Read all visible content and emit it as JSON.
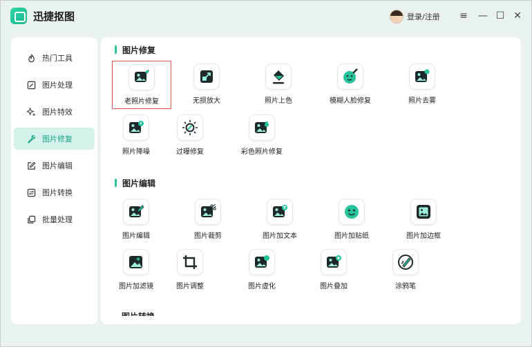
{
  "app": {
    "title": "迅捷抠图",
    "login_label": "登录/注册"
  },
  "window_controls": {
    "menu": "≡",
    "minimize": "—",
    "maximize": "☐",
    "close": "✕"
  },
  "sidebar": {
    "items": [
      {
        "label": "热门工具",
        "icon": "fire-icon",
        "active": false
      },
      {
        "label": "图片处理",
        "icon": "image-edit-icon",
        "active": false
      },
      {
        "label": "图片特效",
        "icon": "sparkle-icon",
        "active": false
      },
      {
        "label": "图片修复",
        "icon": "wrench-icon",
        "active": true
      },
      {
        "label": "图片编辑",
        "icon": "pencil-square-icon",
        "active": false
      },
      {
        "label": "图片转换",
        "icon": "convert-icon",
        "active": false
      },
      {
        "label": "批量处理",
        "icon": "stack-icon",
        "active": false
      }
    ]
  },
  "sections": [
    {
      "title": "图片修复",
      "tools": [
        {
          "label": "老照片修复",
          "icon": "old-photo-repair-icon",
          "selected": true
        },
        {
          "label": "无损放大",
          "icon": "upscale-icon"
        },
        {
          "label": "照片上色",
          "icon": "paint-bucket-icon"
        },
        {
          "label": "模糊人脸修复",
          "icon": "face-repair-icon"
        },
        {
          "label": "照片去雾",
          "icon": "dehaze-icon"
        },
        {
          "label": "照片降噪",
          "icon": "denoise-icon"
        },
        {
          "label": "过曝修复",
          "icon": "exposure-icon"
        },
        {
          "label": "彩色照片修复",
          "icon": "color-photo-icon"
        }
      ]
    },
    {
      "title": "图片编辑",
      "tools": [
        {
          "label": "图片编辑",
          "icon": "image-edit-tool-icon"
        },
        {
          "label": "图片裁剪",
          "icon": "scissors-icon"
        },
        {
          "label": "图片加文本",
          "icon": "add-text-icon"
        },
        {
          "label": "图片加贴纸",
          "icon": "sticker-icon"
        },
        {
          "label": "图片加边框",
          "icon": "frame-icon"
        },
        {
          "label": "图片加滤镜",
          "icon": "filter-icon"
        },
        {
          "label": "图片调整",
          "icon": "crop-icon"
        },
        {
          "label": "图片虚化",
          "icon": "blur-icon"
        },
        {
          "label": "图片叠加",
          "icon": "overlay-icon"
        },
        {
          "label": "涂鸦笔",
          "icon": "brush-icon"
        }
      ]
    },
    {
      "title": "图片转换"
    }
  ],
  "colors": {
    "accent": "#27c39b",
    "active_bg": "#d5f2ea",
    "icon_dark": "#1e2a2a",
    "selection": "#d9534f"
  }
}
